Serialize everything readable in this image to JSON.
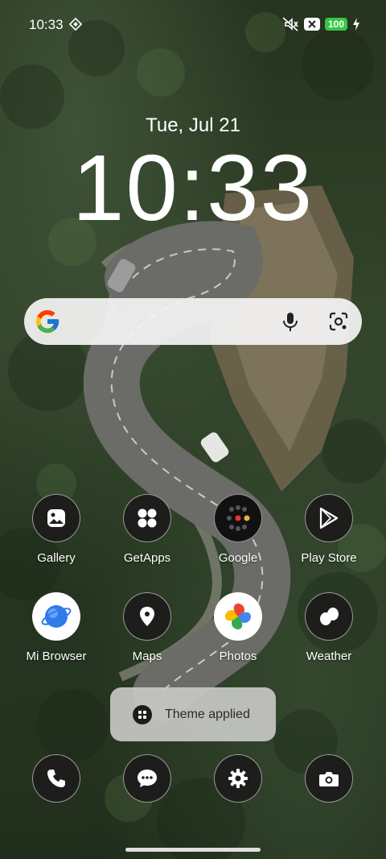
{
  "status_bar": {
    "time": "10:33",
    "battery": "100"
  },
  "clock_widget": {
    "date": "Tue, Jul 21",
    "time": "10:33"
  },
  "search_bar": {},
  "apps": [
    {
      "label": "Gallery"
    },
    {
      "label": "GetApps"
    },
    {
      "label": "Google"
    },
    {
      "label": "Play Store"
    },
    {
      "label": "Mi Browser"
    },
    {
      "label": "Maps"
    },
    {
      "label": "Photos"
    },
    {
      "label": "Weather"
    }
  ],
  "toast": {
    "text": "Theme applied"
  },
  "dock": [
    "phone-icon",
    "messages-icon",
    "settings-icon",
    "camera-icon"
  ],
  "colors": {
    "battery": "#36c746",
    "icon_bg": "#1d1e1c"
  }
}
